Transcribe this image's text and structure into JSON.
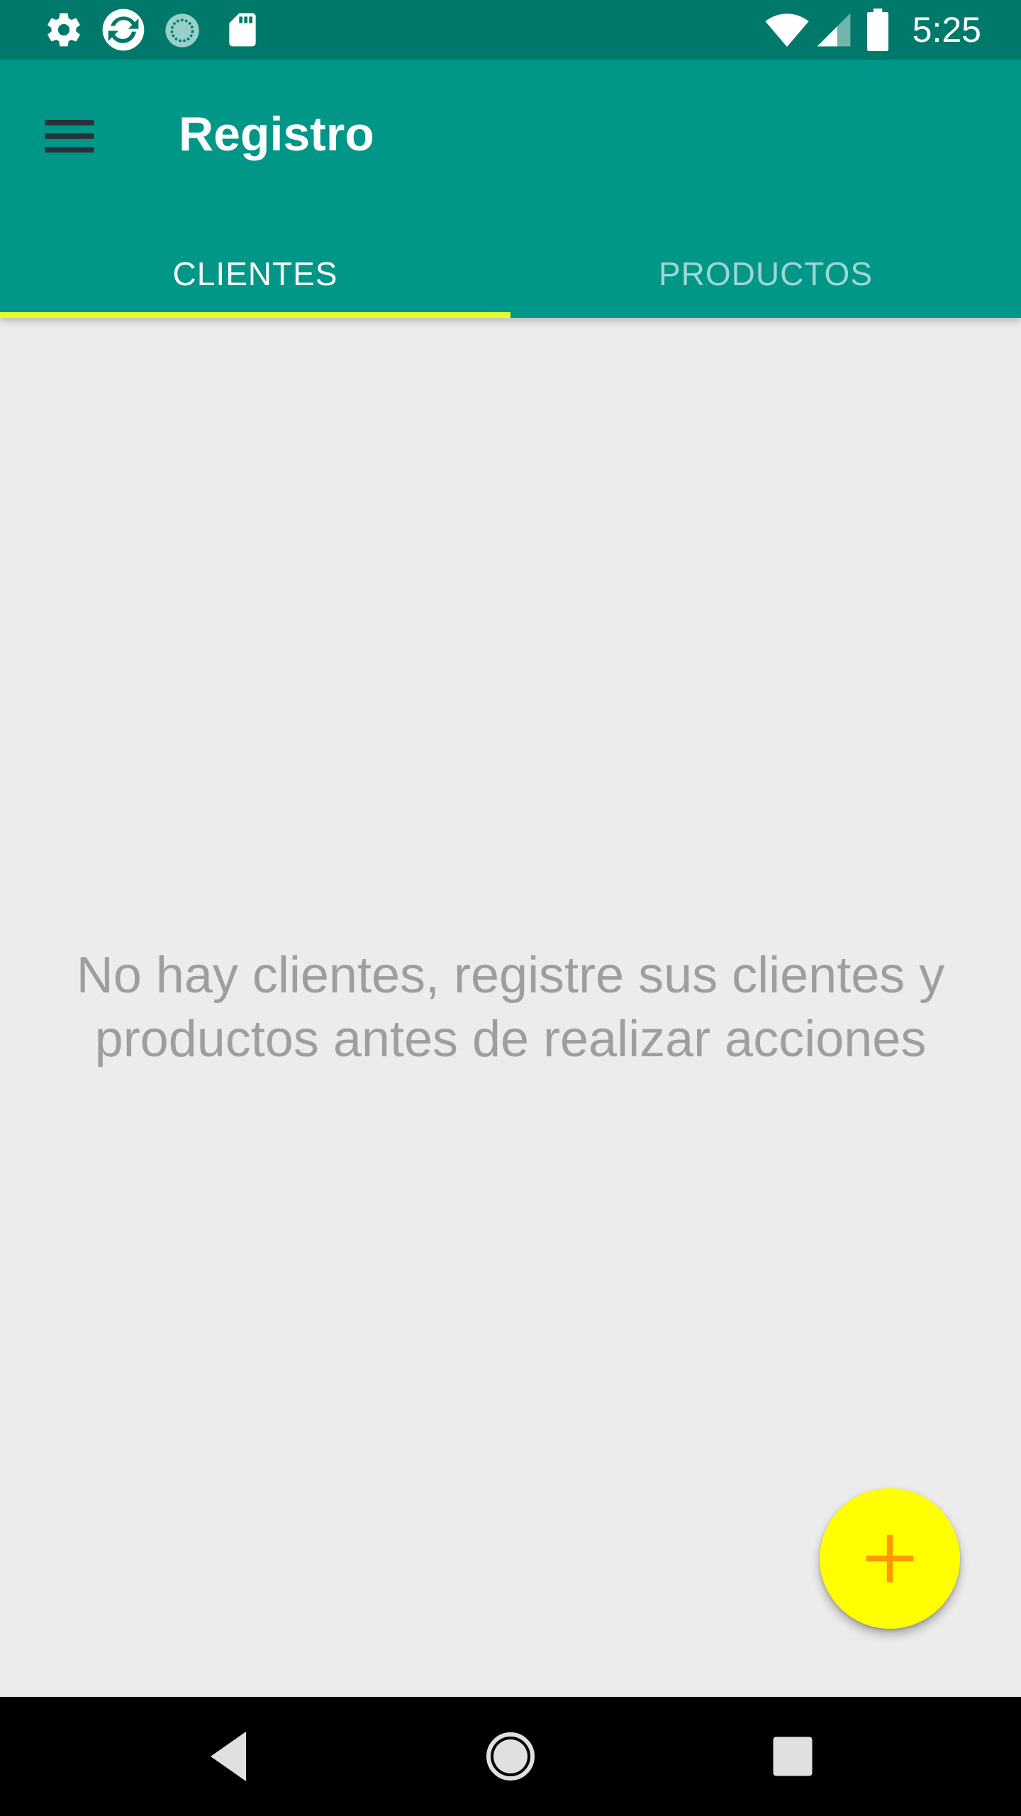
{
  "status_bar": {
    "time": "5:25",
    "left_icons": [
      "gear-icon",
      "sync-icon",
      "loading-icon",
      "sd-card-icon"
    ],
    "right_icons": [
      "wifi-icon",
      "cell-signal-icon",
      "battery-icon"
    ]
  },
  "app_bar": {
    "title": "Registro",
    "menu_icon": "hamburger-menu-icon",
    "color": "#009688"
  },
  "tabs": [
    {
      "label": "CLIENTES",
      "selected": true
    },
    {
      "label": "PRODUCTOS",
      "selected": false
    }
  ],
  "tab_indicator_color": "#e5ff2a",
  "empty_state": {
    "message": "No hay clientes, registre sus clientes y productos antes de realizar acciones"
  },
  "fab": {
    "icon": "plus-icon",
    "background": "#ffff00",
    "icon_color": "#ff9800"
  },
  "nav_bar": {
    "icons": [
      "back-icon",
      "home-icon",
      "recents-icon"
    ]
  }
}
